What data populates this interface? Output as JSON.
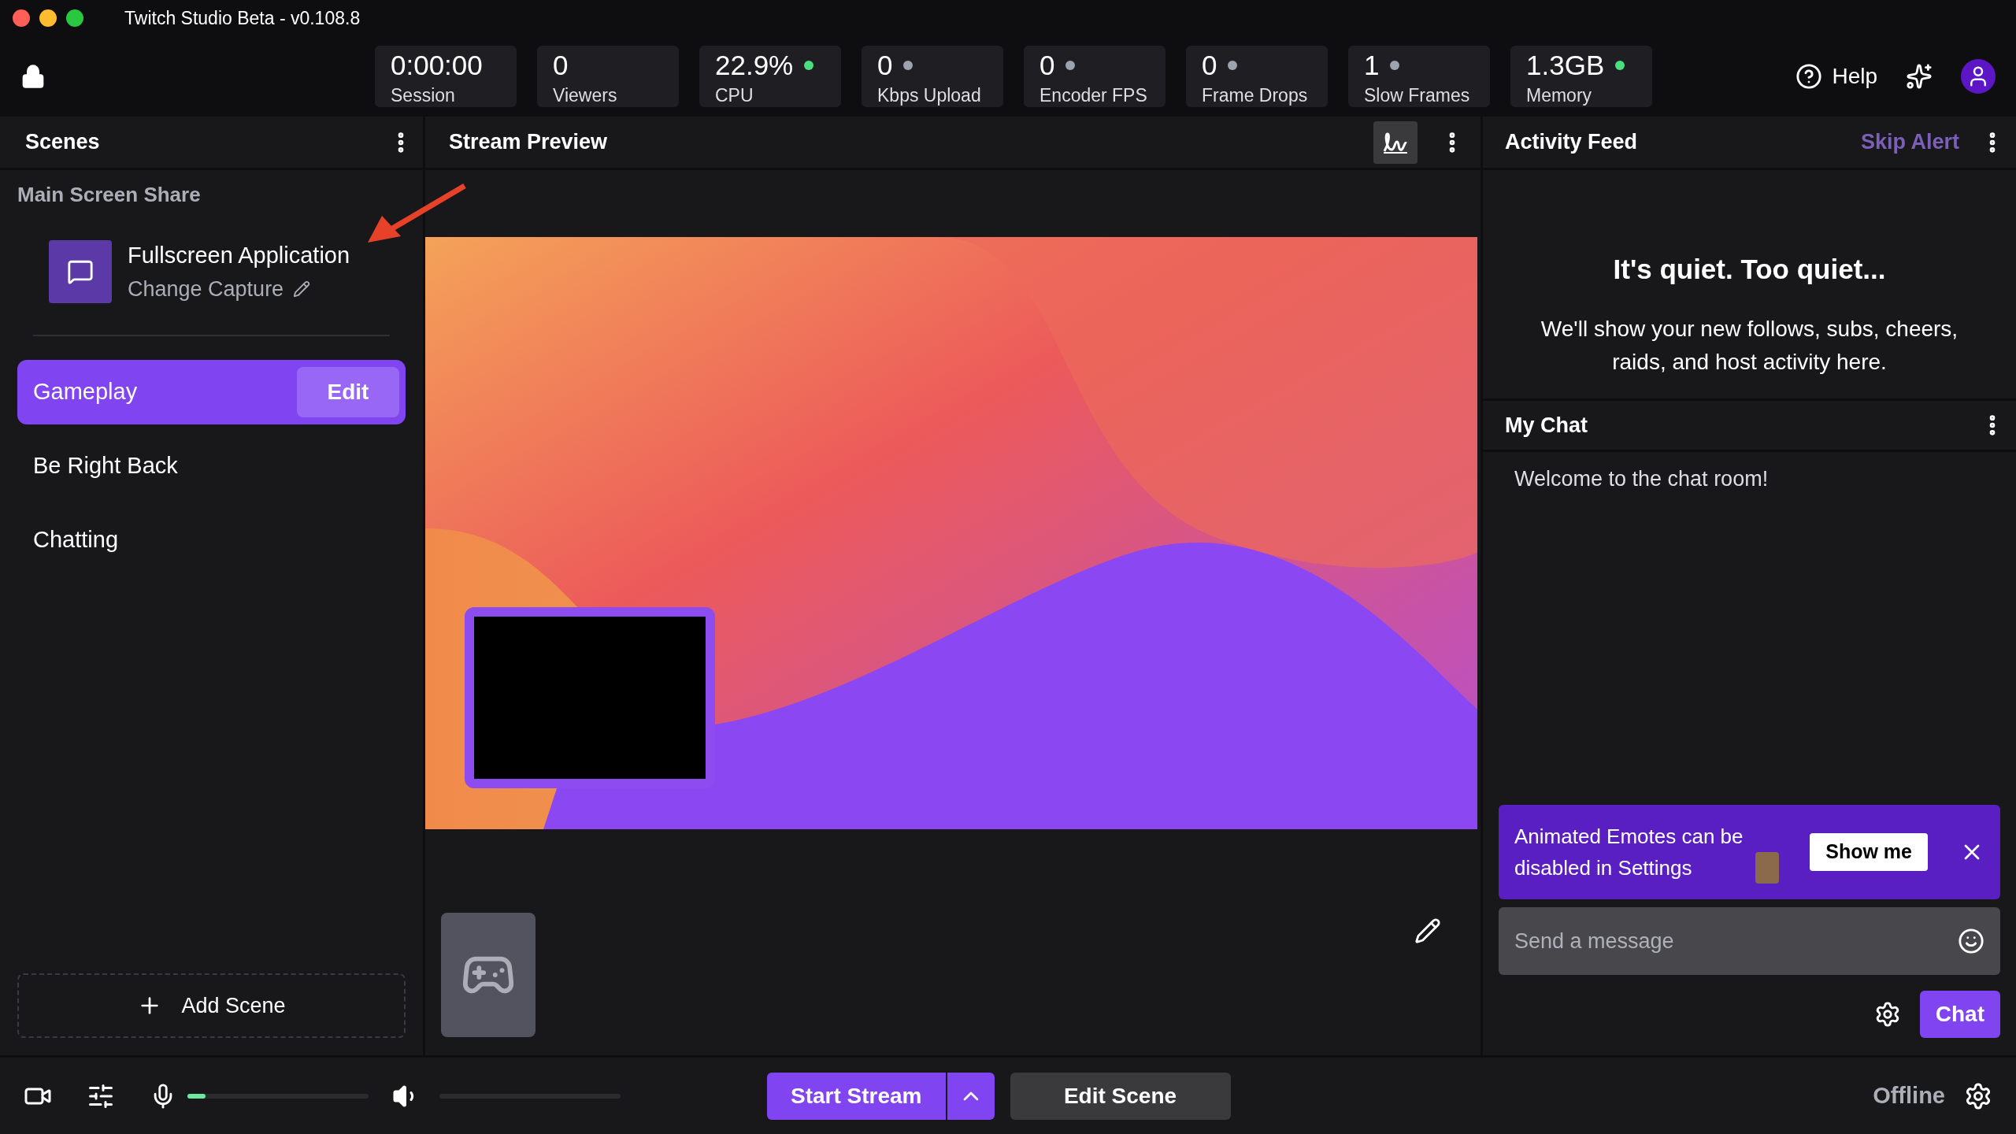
{
  "window": {
    "title": "Twitch Studio Beta - v0.108.8"
  },
  "stats": [
    {
      "value": "0:00:00",
      "label": "Session"
    },
    {
      "value": "0",
      "label": "Viewers"
    },
    {
      "value": "22.9%",
      "label": "CPU",
      "color": "#4ade80"
    },
    {
      "value": "0",
      "label": "Kbps Upload",
      "color": "#9ca3af"
    },
    {
      "value": "0",
      "label": "Encoder FPS",
      "color": "#9ca3af"
    },
    {
      "value": "0",
      "label": "Frame Drops",
      "color": "#9ca3af"
    },
    {
      "value": "1",
      "label": "Slow Frames",
      "color": "#9ca3af"
    },
    {
      "value": "1.3GB",
      "label": "Memory",
      "color": "#4ade80"
    }
  ],
  "help": "Help",
  "scenes": {
    "title": "Scenes",
    "group": "Main Screen Share",
    "capture": {
      "title": "Fullscreen Application",
      "action": "Change Capture"
    },
    "edit": "Edit",
    "items": [
      {
        "name": "Gameplay",
        "selected": true
      },
      {
        "name": "Be Right Back",
        "selected": false
      },
      {
        "name": "Chatting",
        "selected": false
      }
    ],
    "add": "Add Scene"
  },
  "preview": {
    "title": "Stream Preview"
  },
  "activity": {
    "title": "Activity Feed",
    "skip": "Skip Alert",
    "heading": "It's quiet. Too quiet...",
    "body": "We'll show your new follows, subs, cheers, raids, and host activity here."
  },
  "chat": {
    "title": "My Chat",
    "messages": [
      "Welcome to the chat room!"
    ],
    "banner": {
      "text": "Animated Emotes can be disabled in Settings",
      "button": "Show me"
    },
    "placeholder": "Send a message",
    "send": "Chat"
  },
  "bottom": {
    "mic": {
      "level": 0.1
    },
    "volume": {
      "level": 0
    },
    "start": "Start Stream",
    "edit": "Edit Scene",
    "status": "Offline"
  }
}
